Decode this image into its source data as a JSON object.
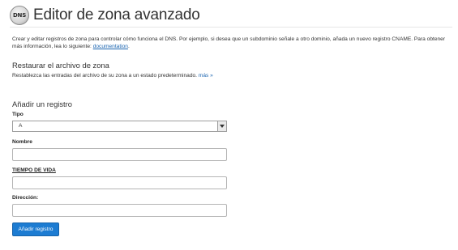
{
  "header": {
    "icon_text": "DNS",
    "title": "Editor de zona avanzado"
  },
  "intro": {
    "text": "Crear y editar registros de zona para controlar cómo funciona el DNS. Por ejemplo, si desea que un subdominio señale a otro dominio, añada un nuevo registro CNAME. Para obtener más información, lea lo siguiente: ",
    "link": "documentation",
    "trailing": "."
  },
  "restore": {
    "title": "Restaurar el archivo de zona",
    "description": "Restablezca las entradas del archivo de su zona a un estado predeterminado. ",
    "more_link": "más »"
  },
  "add_record": {
    "title": "Añadir un registro",
    "type_label": "Tipo",
    "type_value": "A",
    "name_label": "Nombre",
    "name_value": "",
    "ttl_label": "TIEMPO DE VIDA",
    "ttl_value": "",
    "address_label": "Dirección:",
    "address_value": "",
    "submit_label": "Añadir registro"
  },
  "colors": {
    "accent": "#1d7cd2",
    "link": "#1a64b0"
  }
}
